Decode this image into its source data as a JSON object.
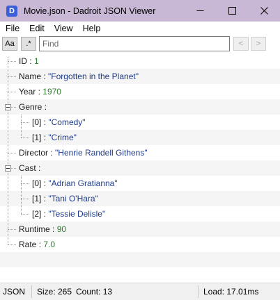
{
  "window": {
    "title": "Movie.json - Dadroit JSON Viewer",
    "app_icon_letter": "D"
  },
  "menu": [
    "File",
    "Edit",
    "View",
    "Help"
  ],
  "toolbar": {
    "case_label": "Aa",
    "regex_label": ".*",
    "find_placeholder": "Find",
    "find_value": "",
    "prev_label": "<",
    "next_label": ">"
  },
  "tree": {
    "id": {
      "key": "ID",
      "sep": " : ",
      "value": "1"
    },
    "name": {
      "key": "Name",
      "sep": " : ",
      "value": "\"Forgotten in the Planet\""
    },
    "year": {
      "key": "Year",
      "sep": " : ",
      "value": "1970"
    },
    "genre": {
      "key": "Genre",
      "sep": " :",
      "items": [
        {
          "key": "[0]",
          "sep": "  : ",
          "value": "\"Comedy\""
        },
        {
          "key": "[1]",
          "sep": "  : ",
          "value": "\"Crime\""
        }
      ]
    },
    "director": {
      "key": "Director",
      "sep": " : ",
      "value": "\"Henrie Randell Githens\""
    },
    "cast": {
      "key": "Cast",
      "sep": " :",
      "items": [
        {
          "key": "[0]",
          "sep": "  : ",
          "value": "\"Adrian Gratianna\""
        },
        {
          "key": "[1]",
          "sep": "  : ",
          "value": "\"Tani O'Hara\""
        },
        {
          "key": "[2]",
          "sep": "  : ",
          "value": "\"Tessie Delisle\""
        }
      ]
    },
    "runtime": {
      "key": "Runtime",
      "sep": " : ",
      "value": "90"
    },
    "rate": {
      "key": "Rate",
      "sep": " : ",
      "value": "7.0"
    }
  },
  "status": {
    "format": "JSON",
    "size": "Size: 265",
    "count": "Count: 13",
    "load": "Load: 17.01ms"
  }
}
